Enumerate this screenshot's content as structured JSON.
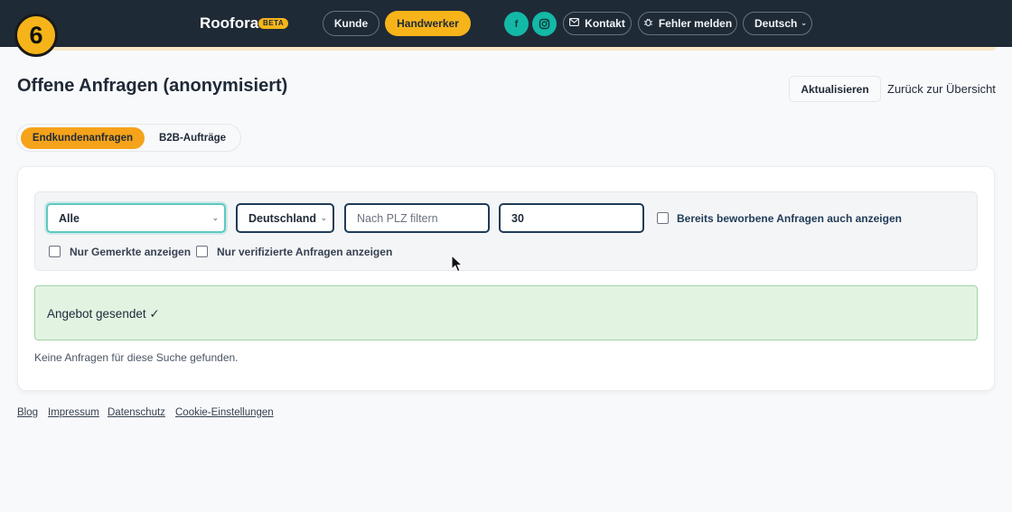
{
  "step_badge": "6",
  "header": {
    "brand": "Roofora",
    "beta": "BETA",
    "role_tabs": [
      "Kunde",
      "Handwerker"
    ],
    "social": [
      "f",
      "instagram-icon"
    ],
    "contact_label": "Kontakt",
    "report_label": "Fehler melden",
    "language": "Deutsch",
    "colors": {
      "bar": "#1f2a37",
      "accent": "#f6b41a",
      "social": "#14b8a6"
    }
  },
  "page": {
    "title": "Offene Anfragen (anonymisiert)",
    "refresh_label": "Aktualisieren",
    "back_label": "Zurück zur Übersicht"
  },
  "tabs": [
    "Endkundenanfragen",
    "B2B-Aufträge"
  ],
  "filters": {
    "category_value": "Alle",
    "country_value": "Deutschland",
    "plz_placeholder": "Nach PLZ filtern",
    "radius_value": "30",
    "show_applied_label": "Bereits beworbene Anfragen auch anzeigen",
    "only_saved_label": "Nur Gemerkte anzeigen",
    "only_verified_label": "Nur verifizierte Anfragen anzeigen"
  },
  "alert": {
    "text": "Angebot gesendet ✓",
    "color": "#e3f3e2"
  },
  "empty_text": "Keine Anfragen für diese Suche gefunden.",
  "footer": [
    "Blog",
    "Impressum",
    "Datenschutz",
    "Cookie-Einstellungen"
  ]
}
